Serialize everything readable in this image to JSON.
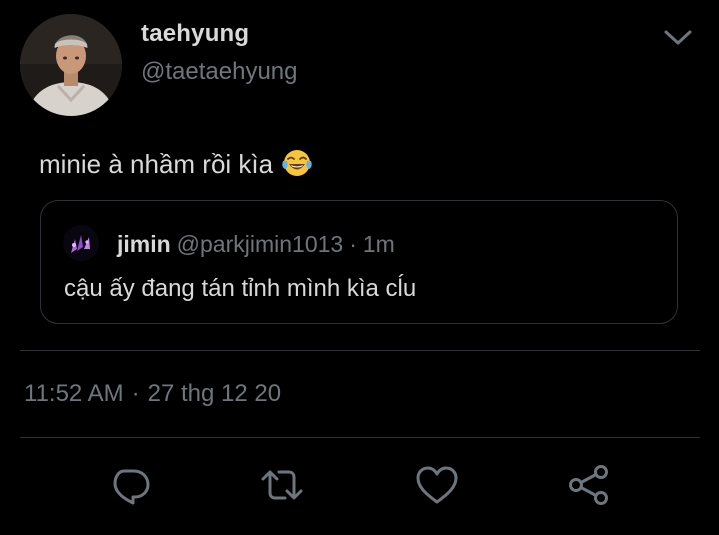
{
  "author": {
    "display_name": "taehyung",
    "handle": "@taetaehyung",
    "avatar": "profile-photo"
  },
  "tweet": {
    "text": "minie à nhầm rồi kìa",
    "emoji": "face-with-tears-of-joy-icon"
  },
  "quoted_tweet": {
    "display_name": "jimin",
    "handle": "@parkjimin1013",
    "separator": "·",
    "time": "1m",
    "text": "cậu ấy đang tán tỉnh mình kìa cĺu"
  },
  "meta": {
    "time": "11:52 AM",
    "separator": "·",
    "date": "27 thg 12 20"
  },
  "actions": [
    {
      "name": "reply",
      "icon": "reply-icon"
    },
    {
      "name": "retweet",
      "icon": "retweet-icon"
    },
    {
      "name": "like",
      "icon": "heart-icon"
    },
    {
      "name": "share",
      "icon": "share-icon"
    }
  ],
  "colors": {
    "background": "#000000",
    "primary_text": "#d9d9d9",
    "secondary_text": "#6e767d",
    "border": "#2f3336"
  }
}
